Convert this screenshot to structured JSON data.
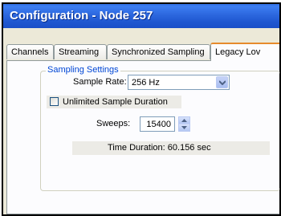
{
  "window": {
    "title": "Configuration - Node 257"
  },
  "tabs": [
    {
      "label": "Channels"
    },
    {
      "label": "Streaming"
    },
    {
      "label": "Synchronized Sampling"
    },
    {
      "label": "Legacy Lov"
    }
  ],
  "sampling": {
    "group_label": "Sampling Settings",
    "sample_rate_label": "Sample Rate:",
    "sample_rate_value": "256 Hz",
    "unlimited_label": "Unlimited Sample Duration",
    "unlimited_checked": false,
    "sweeps_label": "Sweeps:",
    "sweeps_value": "15400",
    "time_duration": "Time Duration: 60.156 sec"
  },
  "icons": {
    "combo_arrow": "chevron-down-icon",
    "spin_up": "caret-up-icon",
    "spin_down": "caret-down-icon"
  }
}
